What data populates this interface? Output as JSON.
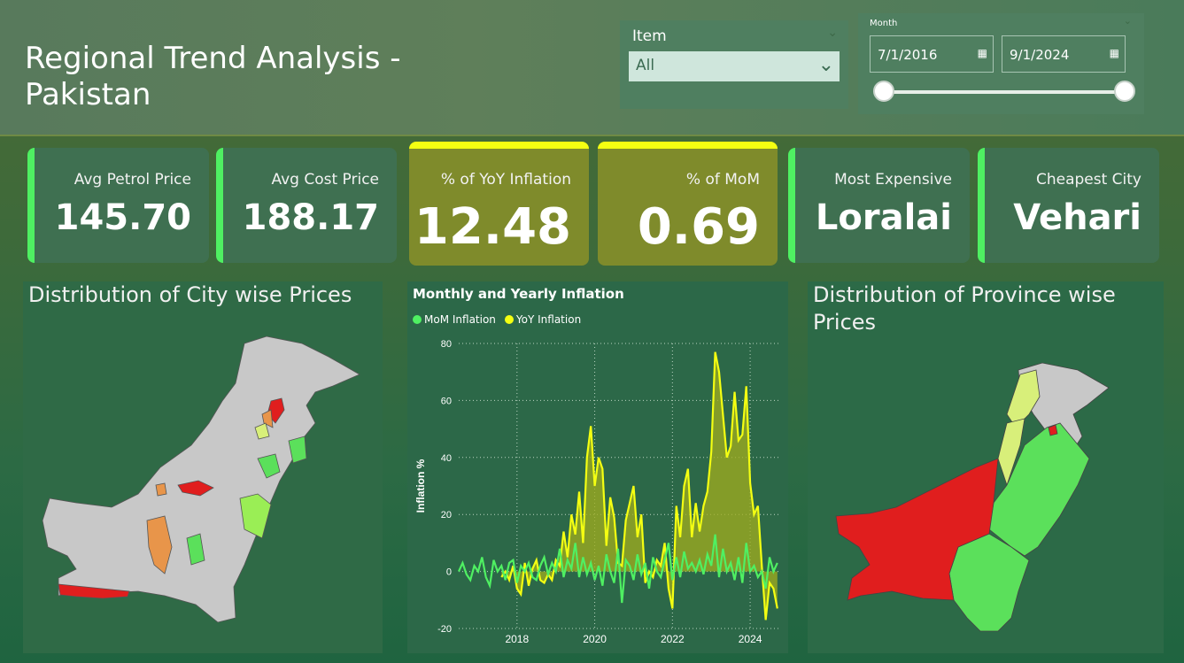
{
  "header": {
    "title": "Regional Trend Analysis - Pakistan"
  },
  "item_slicer": {
    "label": "Item",
    "selected": "All"
  },
  "month_slicer": {
    "label": "Month",
    "start": "7/1/2016",
    "end": "9/1/2024",
    "range_fraction": [
      0.0,
      1.0
    ]
  },
  "kpis": [
    {
      "label": "Avg Petrol Price",
      "value": "145.70"
    },
    {
      "label": "Avg Cost Price",
      "value": "188.17"
    },
    {
      "label": "% of YoY Inflation",
      "value": "12.48"
    },
    {
      "label": "% of MoM",
      "value": "0.69"
    },
    {
      "label": "Most Expensive",
      "value": "Loralai"
    },
    {
      "label": "Cheapest City",
      "value": "Vehari"
    }
  ],
  "city_map": {
    "title": "Distribution of City wise Prices"
  },
  "province_map": {
    "title": "Distribution of Province wise Prices"
  },
  "colors": {
    "accent_green": "#4ff062",
    "accent_yellow": "#f4ff12",
    "map_red": "#e01e1e",
    "map_orange": "#e8954a",
    "map_lightgreen": "#9aee55",
    "map_green": "#5be05b",
    "map_yellowgreen": "#d8ef7a",
    "map_gray": "#c8c8c8"
  },
  "chart_data": {
    "type": "line",
    "title": "Monthly and Yearly Inflation",
    "ylabel": "Inflation %",
    "xlabel": "",
    "ylim": [
      -20,
      80
    ],
    "yticks": [
      80,
      60,
      40,
      20,
      0,
      -20
    ],
    "xticks": [
      2018,
      2020,
      2022,
      2024
    ],
    "xlim": [
      2016.5,
      2024.75
    ],
    "legend": "top-left",
    "grid": true,
    "series": [
      {
        "name": "MoM Inflation",
        "color": "#4ff062",
        "x": [
          2016.5,
          2016.6,
          2016.7,
          2016.8,
          2016.9,
          2017.0,
          2017.1,
          2017.2,
          2017.3,
          2017.4,
          2017.5,
          2017.6,
          2017.7,
          2017.8,
          2017.9,
          2018.0,
          2018.1,
          2018.2,
          2018.3,
          2018.4,
          2018.5,
          2018.6,
          2018.7,
          2018.8,
          2018.9,
          2019.0,
          2019.1,
          2019.2,
          2019.3,
          2019.4,
          2019.5,
          2019.6,
          2019.7,
          2019.8,
          2019.9,
          2020.0,
          2020.1,
          2020.2,
          2020.3,
          2020.4,
          2020.5,
          2020.6,
          2020.7,
          2020.8,
          2020.9,
          2021.0,
          2021.1,
          2021.2,
          2021.3,
          2021.4,
          2021.5,
          2021.6,
          2021.7,
          2021.8,
          2021.9,
          2022.0,
          2022.1,
          2022.2,
          2022.3,
          2022.4,
          2022.5,
          2022.6,
          2022.7,
          2022.8,
          2022.9,
          2023.0,
          2023.1,
          2023.2,
          2023.3,
          2023.4,
          2023.5,
          2023.6,
          2023.7,
          2023.8,
          2023.9,
          2024.0,
          2024.1,
          2024.2,
          2024.3,
          2024.4,
          2024.5,
          2024.6,
          2024.7
        ],
        "values": [
          0,
          3,
          -1,
          -3,
          2,
          0,
          5,
          -2,
          -5,
          4,
          0,
          2,
          -3,
          3,
          4,
          -4,
          2,
          0,
          3,
          -2,
          -3,
          2,
          5,
          -1,
          3,
          0,
          8,
          -2,
          4,
          1,
          10,
          -2,
          5,
          -1,
          3,
          -3,
          2,
          -5,
          6,
          0,
          -4,
          8,
          -11,
          4,
          2,
          -3,
          6,
          -1,
          3,
          -6,
          5,
          0,
          -2,
          4,
          10,
          -3,
          5,
          -2,
          7,
          1,
          3,
          0,
          4,
          -1,
          6,
          2,
          13,
          -2,
          8,
          0,
          3,
          -3,
          5,
          -4,
          10,
          0,
          2,
          -2,
          0,
          -6,
          5,
          0,
          3
        ]
      },
      {
        "name": "YoY Inflation",
        "color": "#f4ff12",
        "x": [
          2017.6,
          2017.7,
          2017.8,
          2017.9,
          2018.0,
          2018.1,
          2018.2,
          2018.3,
          2018.4,
          2018.5,
          2018.6,
          2018.7,
          2018.8,
          2018.9,
          2019.0,
          2019.1,
          2019.2,
          2019.3,
          2019.4,
          2019.5,
          2019.6,
          2019.7,
          2019.8,
          2019.9,
          2020.0,
          2020.1,
          2020.2,
          2020.3,
          2020.4,
          2020.5,
          2020.6,
          2020.7,
          2020.8,
          2020.9,
          2021.0,
          2021.1,
          2021.2,
          2021.3,
          2021.4,
          2021.5,
          2021.6,
          2021.7,
          2021.8,
          2021.9,
          2022.0,
          2022.1,
          2022.2,
          2022.3,
          2022.4,
          2022.5,
          2022.6,
          2022.7,
          2022.8,
          2022.9,
          2023.0,
          2023.1,
          2023.2,
          2023.3,
          2023.4,
          2023.5,
          2023.6,
          2023.7,
          2023.8,
          2023.9,
          2024.0,
          2024.1,
          2024.2,
          2024.3,
          2024.4,
          2024.5,
          2024.6,
          2024.7
        ],
        "values": [
          -2,
          0,
          -3,
          2,
          -6,
          -8,
          3,
          -5,
          1,
          4,
          -3,
          -4,
          -1,
          -3,
          4,
          2,
          14,
          5,
          20,
          13,
          28,
          10,
          40,
          51,
          30,
          40,
          36,
          9,
          26,
          19,
          3,
          2,
          18,
          24,
          30,
          12,
          20,
          -4,
          0,
          -2,
          4,
          2,
          10,
          -6,
          -13,
          23,
          12,
          30,
          36,
          12,
          24,
          14,
          23,
          28,
          42,
          77,
          70,
          55,
          40,
          44,
          63,
          46,
          48,
          65,
          31,
          20,
          23,
          2,
          -17,
          -4,
          -6,
          -13
        ]
      }
    ]
  }
}
